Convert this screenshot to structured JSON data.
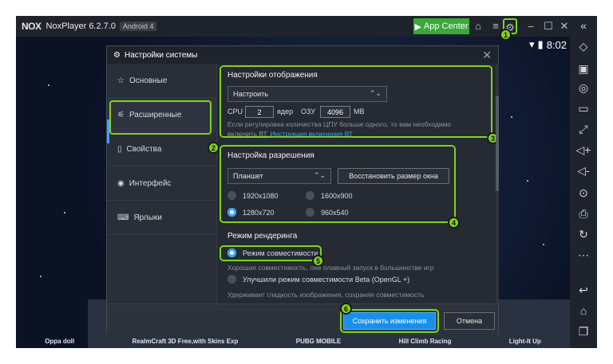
{
  "titlebar": {
    "logo": "NOX",
    "title": "NoxPlayer 6.2.7.0",
    "android": "Android 4",
    "app_center": "App Center"
  },
  "statusbar": {
    "time": "8:02"
  },
  "dialog": {
    "title": "Настройки системы",
    "sidebar": [
      {
        "label": "Основные",
        "icon": "star-icon"
      },
      {
        "label": "Расширенные",
        "icon": "sliders-icon"
      },
      {
        "label": "Свойства",
        "icon": "book-icon"
      },
      {
        "label": "Интерфейс",
        "icon": "eye-icon"
      },
      {
        "label": "Ярлыки",
        "icon": "keyboard-icon"
      }
    ],
    "display": {
      "title": "Настройки отображения",
      "select": "Настроить",
      "cpu_label": "CPU",
      "cpu_value": "2",
      "cores_label": "ядер",
      "ram_label": "ОЗУ",
      "ram_value": "4096",
      "ram_unit": "MB",
      "note": "Если регулировка количества ЦПУ больше одного, то вам необходимо включить ВТ.",
      "link": "Инструкция включения ВТ"
    },
    "resolution": {
      "title": "Настройка разрешения",
      "select": "Планшет",
      "restore_button": "Восстановить размер окна",
      "options": [
        "1920x1080",
        "1600x900",
        "1280x720",
        "960x540"
      ],
      "selected": "1280x720"
    },
    "render": {
      "title": "Режим рендеринга",
      "compat": "Режим совместимости",
      "compat_note": "Хорошая совместимость,  лее плавный запуск в большинстве игр",
      "beta": "Улучшили режим совместимости Beta (OpenGL +)",
      "beta_note": "Удерживает гладкость изображения, сохраняя совместимость"
    },
    "footer": {
      "save": "Сохранить изменения",
      "cancel": "Отмена"
    }
  },
  "dock": [
    "Oppa doll",
    "RealmCraft 3D Free,with Skins Exp",
    "PUBG MOBILE",
    "Hill Climb Racing",
    "Light-It Up"
  ],
  "badges": [
    "1",
    "2",
    "3",
    "4",
    "5",
    "6"
  ],
  "colors": {
    "highlight": "#7ed321",
    "accent": "#3aa3ff",
    "app_center": "#3aa83a"
  }
}
